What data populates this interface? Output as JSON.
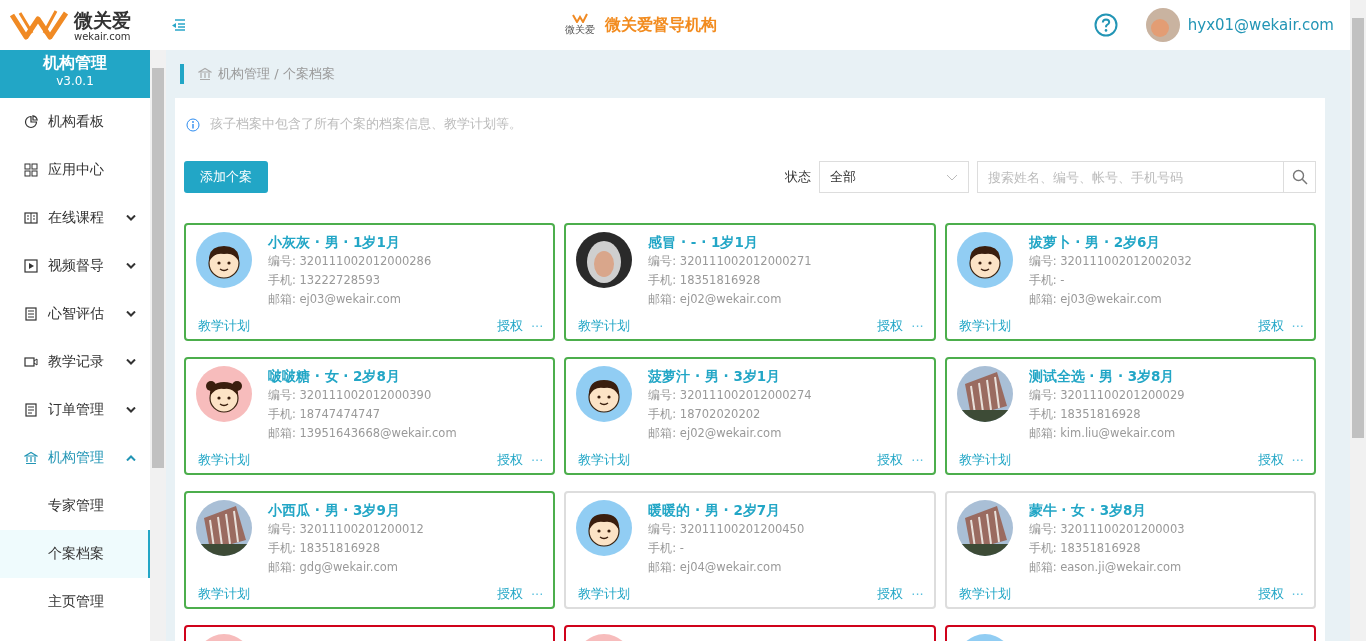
{
  "header": {
    "logo_text": "微关爱",
    "logo_domain": "wekair.com",
    "brand_mark": "微关爱",
    "org_title": "微关爱督导机构",
    "user_email": "hyx01@wekair.com"
  },
  "sidebar": {
    "title": "机构管理",
    "version": "v3.0.1",
    "items": [
      {
        "label": "机构看板",
        "expandable": false,
        "expanded": false
      },
      {
        "label": "应用中心",
        "expandable": false,
        "expanded": false
      },
      {
        "label": "在线课程",
        "expandable": true,
        "expanded": false
      },
      {
        "label": "视频督导",
        "expandable": true,
        "expanded": false
      },
      {
        "label": "心智评估",
        "expandable": true,
        "expanded": false
      },
      {
        "label": "教学记录",
        "expandable": true,
        "expanded": false
      },
      {
        "label": "订单管理",
        "expandable": true,
        "expanded": false
      },
      {
        "label": "机构管理",
        "expandable": true,
        "expanded": true,
        "children": [
          {
            "label": "专家管理",
            "selected": false
          },
          {
            "label": "个案档案",
            "selected": true
          },
          {
            "label": "主页管理",
            "selected": false
          }
        ]
      }
    ]
  },
  "breadcrumb": "机构管理 / 个案档案",
  "info_text": "孩子档案中包含了所有个案的档案信息、教学计划等。",
  "add_button": "添加个案",
  "filter": {
    "label": "状态",
    "value": "全部",
    "search_placeholder": "搜索姓名、编号、帐号、手机号码"
  },
  "cards": [
    {
      "title": "小灰灰 · 男 · 1岁1月",
      "kind": "boy",
      "color": "#4cae4c",
      "id_line": "编号: 320111002012000286",
      "phone_line": "手机: 13222728593",
      "email_line": "邮箱: ej03@wekair.com",
      "plan": "教学计划",
      "auth": "授权",
      "more": "···"
    },
    {
      "title": "感冒 · - · 1岁1月",
      "kind": "photo",
      "color": "#4cae4c",
      "id_line": "编号: 320111002012000271",
      "phone_line": "手机: 18351816928",
      "email_line": "邮箱: ej02@wekair.com",
      "plan": "教学计划",
      "auth": "授权",
      "more": "···"
    },
    {
      "title": "拔萝卜 · 男 · 2岁6月",
      "kind": "boy",
      "color": "#4cae4c",
      "id_line": "编号: 320111002012002032",
      "phone_line": "手机: -",
      "email_line": "邮箱: ej03@wekair.com",
      "plan": "教学计划",
      "auth": "授权",
      "more": "···"
    },
    {
      "title": "啵啵糖 · 女 · 2岁8月",
      "kind": "girl",
      "color": "#4cae4c",
      "id_line": "编号: 320111002012000390",
      "phone_line": "手机: 18747474747",
      "email_line": "邮箱: 13951643668@wekair.com",
      "plan": "教学计划",
      "auth": "授权",
      "more": "···"
    },
    {
      "title": "菠萝汁 · 男 · 3岁1月",
      "kind": "boy",
      "color": "#4cae4c",
      "id_line": "编号: 320111002012000274",
      "phone_line": "手机: 18702020202",
      "email_line": "邮箱: ej02@wekair.com",
      "plan": "教学计划",
      "auth": "授权",
      "more": "···"
    },
    {
      "title": "测试全选 · 男 · 3岁8月",
      "kind": "building",
      "color": "#4cae4c",
      "id_line": "编号: 32011100201200029",
      "phone_line": "手机: 18351816928",
      "email_line": "邮箱: kim.liu@wekair.com",
      "plan": "教学计划",
      "auth": "授权",
      "more": "···"
    },
    {
      "title": "小西瓜 · 男 · 3岁9月",
      "kind": "building",
      "color": "#4cae4c",
      "id_line": "编号: 32011100201200012",
      "phone_line": "手机: 18351816928",
      "email_line": "邮箱: gdg@wekair.com",
      "plan": "教学计划",
      "auth": "授权",
      "more": "···"
    },
    {
      "title": "暖暖的 · 男 · 2岁7月",
      "kind": "boy",
      "color": "#dddddd",
      "id_line": "编号: 32011100201200450",
      "phone_line": "手机: -",
      "email_line": "邮箱: ej04@wekair.com",
      "plan": "教学计划",
      "auth": "授权",
      "more": "···"
    },
    {
      "title": "蒙牛 · 女 · 3岁8月",
      "kind": "building",
      "color": "#dddddd",
      "id_line": "编号: 32011100201200003",
      "phone_line": "手机: 18351816928",
      "email_line": "邮箱: eason.ji@wekair.com",
      "plan": "教学计划",
      "auth": "授权",
      "more": "···"
    },
    {
      "kind": "girl",
      "color": "#d0021b"
    },
    {
      "kind": "girl",
      "color": "#d0021b"
    },
    {
      "kind": "boy",
      "color": "#d0021b"
    }
  ]
}
